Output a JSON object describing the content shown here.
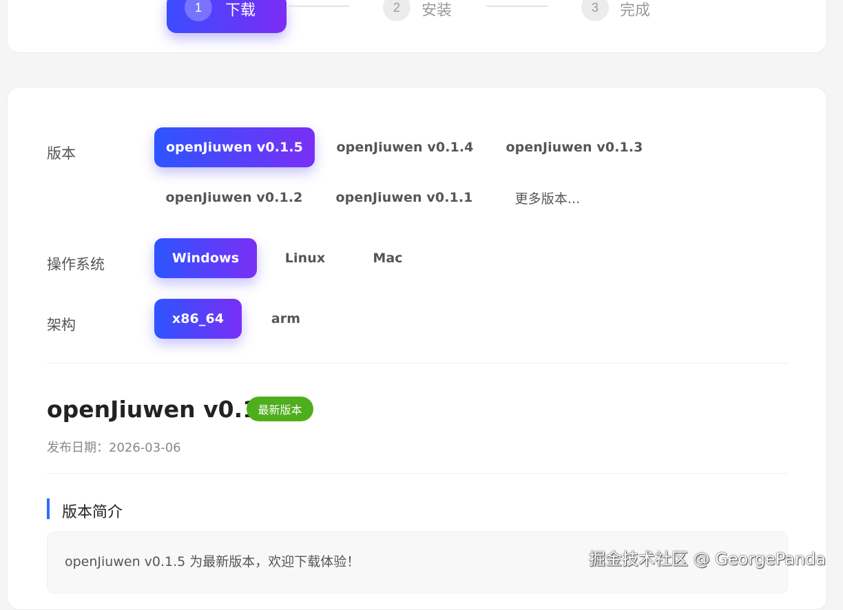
{
  "stepper": {
    "steps": [
      {
        "num": "1",
        "label": "下载"
      },
      {
        "num": "2",
        "label": "安装"
      },
      {
        "num": "3",
        "label": "完成"
      }
    ]
  },
  "selectors": {
    "version": {
      "label": "版本",
      "options": [
        "openJiuwen v0.1.5",
        "openJiuwen v0.1.4",
        "openJiuwen v0.1.3",
        "openJiuwen v0.1.2",
        "openJiuwen v0.1.1",
        "更多版本..."
      ],
      "selected": "openJiuwen v0.1.5"
    },
    "os": {
      "label": "操作系统",
      "options": [
        "Windows",
        "Linux",
        "Mac"
      ],
      "selected": "Windows"
    },
    "arch": {
      "label": "架构",
      "options": [
        "x86_64",
        "arm"
      ],
      "selected": "x86_64"
    }
  },
  "release": {
    "title": "openJiuwen v0.1.5",
    "badge": "最新版本",
    "date_label": "发布日期：2026-03-06",
    "section_title": "版本简介",
    "intro": "openJiuwen v0.1.5 为最新版本，欢迎下载体验！"
  },
  "watermark": "掘金技术社区 @ GeorgePanda",
  "colors": {
    "accent_start": "#2d55ff",
    "accent_end": "#7a2ff5",
    "badge_green": "#4fae1c",
    "section_bar": "#2e6bff"
  }
}
